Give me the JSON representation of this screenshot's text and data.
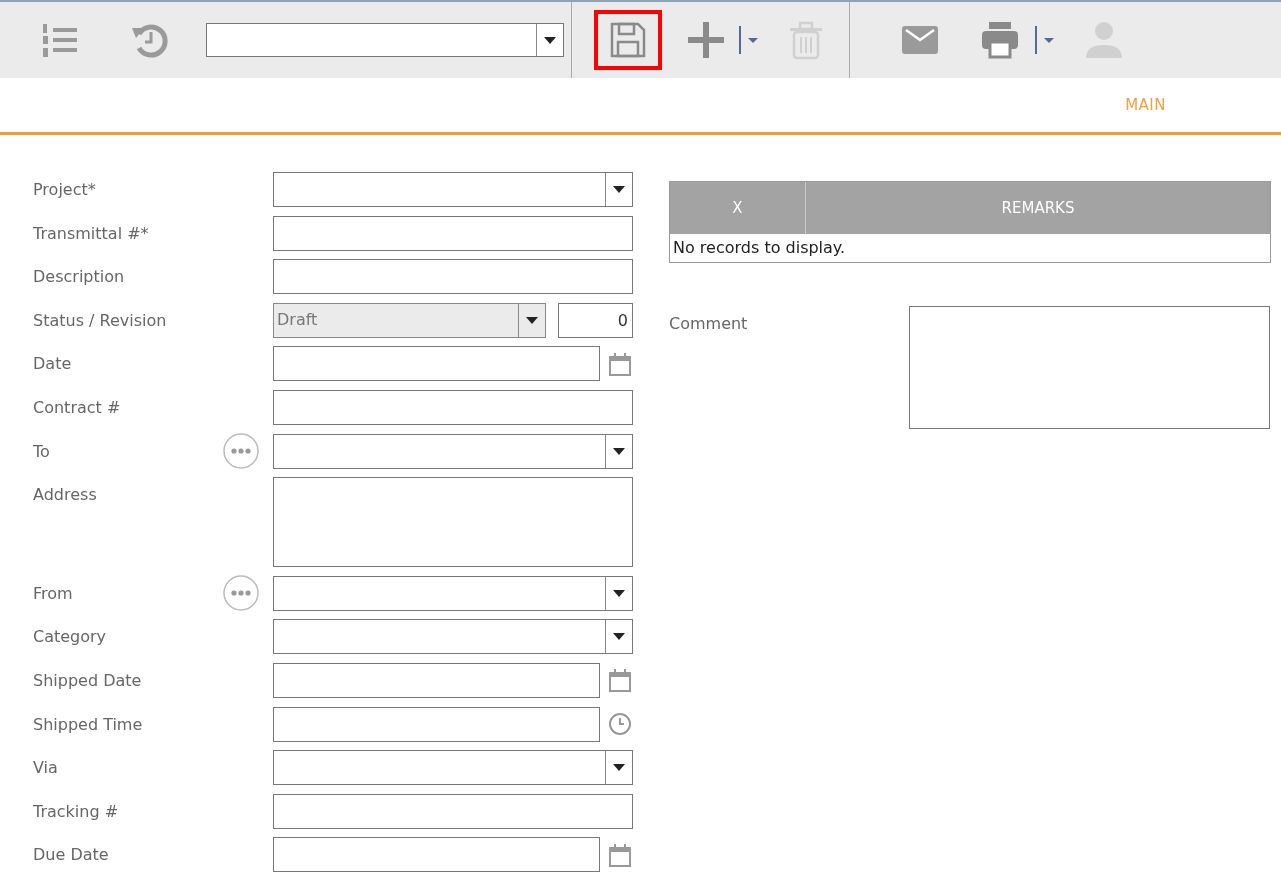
{
  "toolbar": {
    "groups": [
      [
        {
          "kind": "numbered-list",
          "disabled": false,
          "highlighted": false
        },
        {
          "kind": "history",
          "disabled": false,
          "highlighted": false
        },
        {
          "kind": "record-select"
        }
      ],
      [
        {
          "kind": "save",
          "disabled": false,
          "highlighted": true
        },
        {
          "kind": "add",
          "disabled": false,
          "highlighted": false,
          "menu": true
        },
        {
          "kind": "delete",
          "disabled": true,
          "highlighted": false
        }
      ],
      [
        {
          "kind": "mail",
          "disabled": false,
          "highlighted": false
        },
        {
          "kind": "print",
          "disabled": false,
          "highlighted": false,
          "menu": true
        },
        {
          "kind": "user",
          "disabled": true,
          "highlighted": false
        }
      ]
    ]
  },
  "tabs": [
    {
      "label": "MAIN",
      "selected": true
    }
  ],
  "form": {
    "fields": [
      {
        "label": "Project*",
        "kind": "select",
        "disabled": false
      },
      {
        "label": "Transmittal #*",
        "kind": "text"
      },
      {
        "label": "Description",
        "kind": "text"
      },
      {
        "label": "Status / Revision",
        "kind": "select-revision",
        "value": "Draft",
        "disabled": true,
        "revision": "0"
      },
      {
        "label": "Date",
        "kind": "date"
      },
      {
        "label": "Contract #",
        "kind": "text"
      },
      {
        "label": "To",
        "kind": "select",
        "disabled": false,
        "lookup": true
      },
      {
        "label": "Address",
        "kind": "textarea"
      },
      {
        "label": "From",
        "kind": "select",
        "disabled": false,
        "lookup": true
      },
      {
        "label": "Category",
        "kind": "select",
        "disabled": false
      },
      {
        "label": "Shipped Date",
        "kind": "date"
      },
      {
        "label": "Shipped Time",
        "kind": "time"
      },
      {
        "label": "Via",
        "kind": "select",
        "disabled": false
      },
      {
        "label": "Tracking #",
        "kind": "text"
      },
      {
        "label": "Due Date",
        "kind": "date"
      }
    ]
  },
  "grid": {
    "columns": [
      "X",
      "REMARKS"
    ],
    "empty_message": "No records to display."
  },
  "comment": {
    "label": "Comment"
  }
}
